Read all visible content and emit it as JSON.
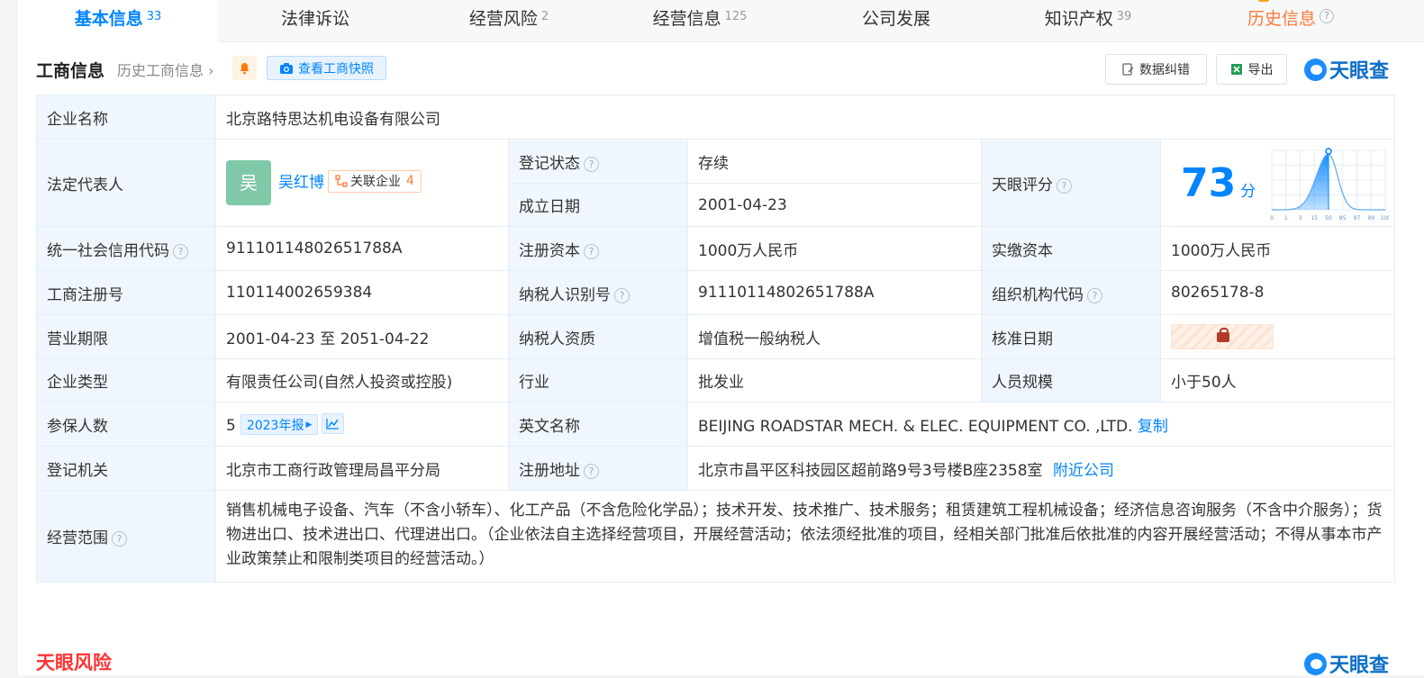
{
  "tabs": [
    {
      "label": "基本信息",
      "count": "33"
    },
    {
      "label": "法律诉讼",
      "count": ""
    },
    {
      "label": "经营风险",
      "count": "2"
    },
    {
      "label": "经营信息",
      "count": "125"
    },
    {
      "label": "公司发展",
      "count": ""
    },
    {
      "label": "知识产权",
      "count": "39"
    },
    {
      "label": "历史信息",
      "count": ""
    }
  ],
  "toolbar": {
    "title": "工商信息",
    "history_link": "历史工商信息",
    "snapshot_label": "查看工商快照",
    "correct_label": "数据纠错",
    "export_label": "导出",
    "logo_text": "天眼查"
  },
  "help_glyph": "?",
  "rows": {
    "name": {
      "label": "企业名称",
      "value": "北京路特思达机电设备有限公司"
    },
    "legal_rep": {
      "label": "法定代表人",
      "avatar_char": "吴",
      "name": "吴红博",
      "related_label": "关联企业",
      "related_count": "4"
    },
    "reg_status": {
      "label": "登记状态",
      "value": "存续"
    },
    "founded": {
      "label": "成立日期",
      "value": "2001-04-23"
    },
    "score": {
      "label": "天眼评分",
      "value": "73",
      "unit": "分"
    },
    "credit_code": {
      "label": "统一社会信用代码",
      "value": "91110114802651788A"
    },
    "reg_capital": {
      "label": "注册资本",
      "value": "1000万人民币"
    },
    "paid_capital": {
      "label": "实缴资本",
      "value": "1000万人民币"
    },
    "reg_no": {
      "label": "工商注册号",
      "value": "110114002659384"
    },
    "taxpayer_id": {
      "label": "纳税人识别号",
      "value": "91110114802651788A"
    },
    "org_code": {
      "label": "组织机构代码",
      "value": "80265178-8"
    },
    "term": {
      "label": "营业期限",
      "value": "2001-04-23 至 2051-04-22"
    },
    "tax_qual": {
      "label": "纳税人资质",
      "value": "增值税一般纳税人"
    },
    "approved": {
      "label": "核准日期"
    },
    "type": {
      "label": "企业类型",
      "value": "有限责任公司(自然人投资或控股)"
    },
    "industry": {
      "label": "行业",
      "value": "批发业"
    },
    "staff": {
      "label": "人员规模",
      "value": "小于50人"
    },
    "insured": {
      "label": "参保人数",
      "value": "5",
      "report_label": "2023年报"
    },
    "english": {
      "label": "英文名称",
      "value": "BEIJING ROADSTAR MECH. & ELEC. EQUIPMENT CO. ,LTD.",
      "copy_label": "复制"
    },
    "authority": {
      "label": "登记机关",
      "value": "北京市工商行政管理局昌平分局"
    },
    "address": {
      "label": "注册地址",
      "value": "北京市昌平区科技园区超前路9号3号楼B座2358室",
      "nearby_label": "附近公司"
    },
    "scope": {
      "label": "经营范围",
      "value": "销售机械电子设备、汽车（不含小轿车）、化工产品（不含危险化学品）；技术开发、技术推广、技术服务；租赁建筑工程机械设备；经济信息咨询服务（不含中介服务）；货物进出口、技术进出口、代理进出口。（企业依法自主选择经营项目，开展经营活动；依法须经批准的项目，经相关部门批准后依批准的内容开展经营活动；不得从事本市产业政策禁止和限制类项目的经营活动。）"
    }
  },
  "score_chart": {
    "ticks": [
      "0",
      "1",
      "3",
      "15",
      "50",
      "85",
      "97",
      "99",
      "100"
    ],
    "marker_tick": "50",
    "color": "#0084ff"
  },
  "bottom": {
    "section_title": "天眼风险",
    "logo_text": "天眼查"
  }
}
